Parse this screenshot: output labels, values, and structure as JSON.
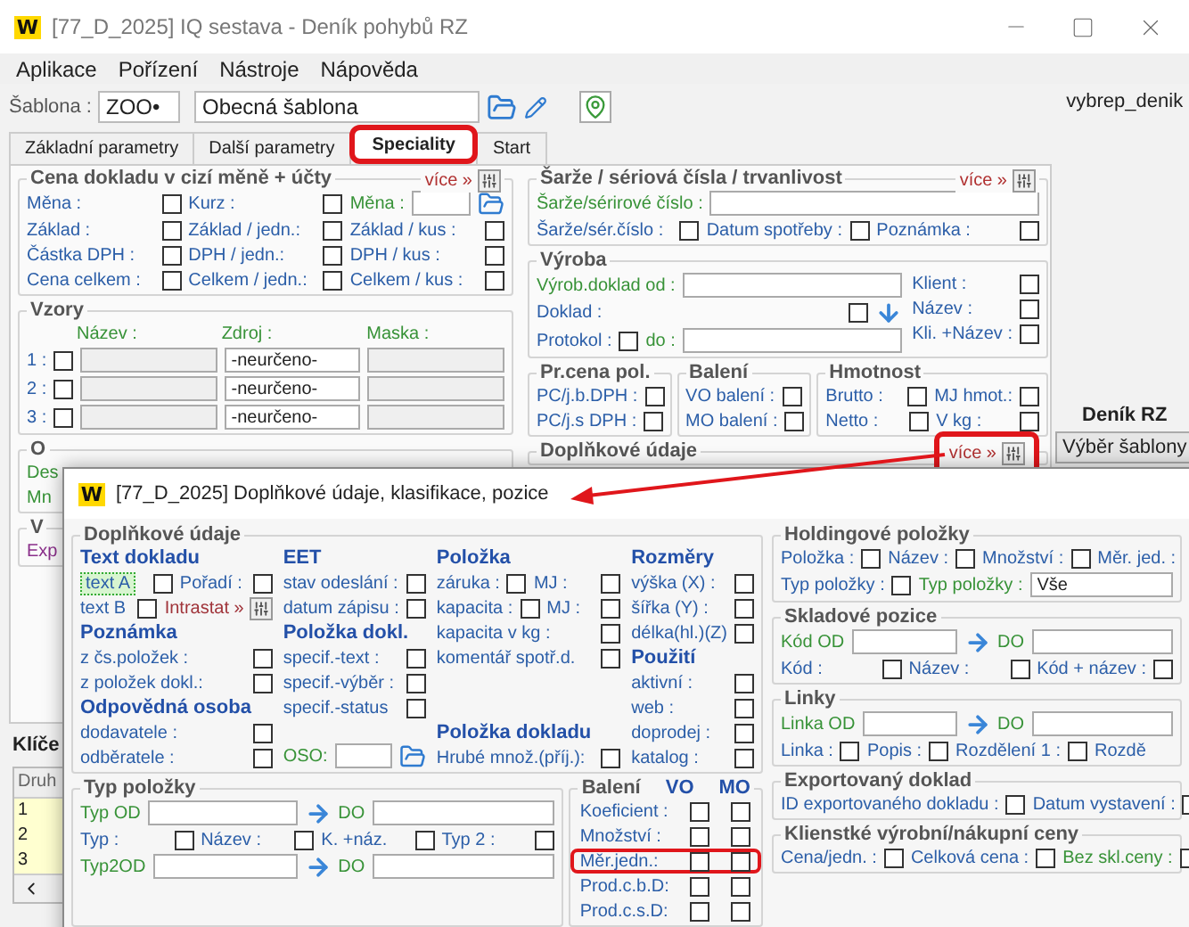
{
  "window": {
    "logo": "W",
    "title": "[77_D_2025] IQ sestava - Deník pohybů RZ"
  },
  "menu": [
    "Aplikace",
    "Pořízení",
    "Nástroje",
    "Nápověda"
  ],
  "template": {
    "label": "Šablona :",
    "code": "ZOO•",
    "name": "Obecná šablona"
  },
  "side": {
    "name": "vybrep_denik",
    "title": "Deník RZ",
    "button": "Výběr šablony"
  },
  "tabs": [
    {
      "label": "Základní parametry",
      "selected": false,
      "highlighted": false
    },
    {
      "label": "Další parametry",
      "selected": false,
      "highlighted": false
    },
    {
      "label": "Speciality",
      "selected": true,
      "highlighted": true
    },
    {
      "label": "Start",
      "selected": false,
      "highlighted": false
    }
  ],
  "panel": {
    "left": [
      {
        "kind": "group",
        "title": "Cena dokladu v cizí měně + účty",
        "more": {
          "label": "více »",
          "highlighted": false
        },
        "rows": [
          [
            {
              "kind": "check",
              "label": "Měna :",
              "checked": false
            },
            {
              "kind": "check",
              "label": "Kurz :",
              "checked": false
            },
            {
              "kind": "input",
              "label": "Měna :",
              "browse": true
            }
          ],
          [
            {
              "kind": "check",
              "label": "Základ :",
              "checked": false
            },
            {
              "kind": "check",
              "label": "Základ / jedn.:",
              "checked": false
            },
            {
              "kind": "check",
              "label": "Základ / kus :",
              "checked": false
            }
          ],
          [
            {
              "kind": "check",
              "label": "Částka DPH :",
              "checked": false
            },
            {
              "kind": "check",
              "label": "DPH / jedn.:",
              "checked": false
            },
            {
              "kind": "check",
              "label": "DPH / kus :",
              "checked": false
            }
          ],
          [
            {
              "kind": "check",
              "label": "Cena celkem :",
              "checked": false
            },
            {
              "kind": "check",
              "label": "Celkem / jedn.:",
              "checked": false
            },
            {
              "kind": "check",
              "label": "Celkem / kus :",
              "checked": false
            }
          ]
        ]
      },
      {
        "kind": "group",
        "title": "Vzory",
        "rows": [
          [
            {
              "kind": "header",
              "label": "Název :"
            },
            {
              "kind": "header",
              "label": "Zdroj :"
            },
            {
              "kind": "header",
              "label": "Maska :"
            }
          ],
          [
            {
              "kind": "check",
              "label": "1 :",
              "checked": false
            },
            {
              "kind": "input",
              "disabled": true
            },
            {
              "kind": "input",
              "value": "-neurčeno-",
              "disabled": false
            },
            {
              "kind": "input",
              "disabled": true
            }
          ],
          [
            {
              "kind": "check",
              "label": "2 :",
              "checked": false
            },
            {
              "kind": "input",
              "disabled": true
            },
            {
              "kind": "input",
              "value": "-neurčeno-",
              "disabled": false
            },
            {
              "kind": "input",
              "disabled": true
            }
          ],
          [
            {
              "kind": "check",
              "label": "3 :",
              "checked": false
            },
            {
              "kind": "input",
              "disabled": true
            },
            {
              "kind": "input",
              "value": "-neurčeno-",
              "disabled": false
            },
            {
              "kind": "input",
              "disabled": true
            }
          ]
        ]
      },
      {
        "kind": "group",
        "title": "O",
        "rows": [
          [
            {
              "kind": "text",
              "label": "Des",
              "color": "#379237"
            }
          ],
          [
            {
              "kind": "text",
              "label": "Mn",
              "color": "#379237"
            }
          ]
        ]
      },
      {
        "kind": "group",
        "title": "V",
        "rows": [
          [
            {
              "kind": "text",
              "label": "Exp",
              "color": "#8a2f8a"
            }
          ]
        ]
      }
    ],
    "right": [
      {
        "kind": "group",
        "title": "Šarže / sériová čísla / trvanlivost",
        "more": {
          "label": "více »",
          "highlighted": false
        },
        "rows": [
          [
            {
              "kind": "input",
              "label": "Šarže/sérirové číslo :"
            }
          ],
          [
            {
              "kind": "check",
              "label": "Šarže/sér.číslo :",
              "checked": false
            },
            {
              "kind": "check",
              "label": "Datum spotřeby :",
              "checked": false
            },
            {
              "kind": "check",
              "label": "Poznámka :",
              "checked": false
            }
          ]
        ]
      },
      {
        "kind": "group",
        "title": "Výroba",
        "columns": [
          {
            "rows": [
              [
                {
                  "kind": "input",
                  "label": "Výrob.doklad od :"
                }
              ],
              [
                {
                  "kind": "check",
                  "label": "Doklad :",
                  "checked": false
                },
                {
                  "kind": "arrow_down"
                }
              ],
              [
                {
                  "kind": "check",
                  "label": "Protokol :",
                  "checked": false
                },
                {
                  "kind": "input",
                  "label": "do :"
                }
              ]
            ]
          },
          {
            "rows": [
              [
                {
                  "kind": "check",
                  "label": "Klient :",
                  "checked": false
                }
              ],
              [
                {
                  "kind": "check",
                  "label": "Název :",
                  "checked": false
                }
              ],
              [
                {
                  "kind": "check",
                  "label": "Kli. +Název :",
                  "checked": false
                }
              ]
            ]
          }
        ]
      },
      {
        "kind": "group_row",
        "groups": [
          {
            "title": "Pr.cena pol.",
            "rows": [
              [
                {
                  "kind": "check",
                  "label": "PC/j.b.DPH :",
                  "checked": false
                }
              ],
              [
                {
                  "kind": "check",
                  "label": "PC/j.s DPH :",
                  "checked": false
                }
              ]
            ]
          },
          {
            "title": "Balení",
            "rows": [
              [
                {
                  "kind": "check",
                  "label": "VO balení :",
                  "checked": false
                }
              ],
              [
                {
                  "kind": "check",
                  "label": "MO balení :",
                  "checked": false
                }
              ]
            ]
          },
          {
            "title": "Hmotnost",
            "rows": [
              [
                {
                  "kind": "check",
                  "label": "Brutto :",
                  "checked": false
                },
                {
                  "kind": "check",
                  "label": "MJ hmot.:",
                  "checked": false
                }
              ],
              [
                {
                  "kind": "check",
                  "label": "Netto :",
                  "checked": false
                },
                {
                  "kind": "check",
                  "label": "V kg :",
                  "checked": false
                }
              ]
            ]
          }
        ]
      },
      {
        "kind": "group",
        "title": "Doplňkové údaje",
        "more": {
          "label": "více »",
          "highlighted": true
        }
      }
    ]
  },
  "keys": {
    "title": "Klíče",
    "column": "Druh",
    "rows": [
      "1",
      "2",
      "3"
    ]
  },
  "callout_arrow": true,
  "dialog": {
    "logo": "W",
    "title": "[77_D_2025] Doplňkové údaje, klasifikace, pozice",
    "left": [
      {
        "kind": "group",
        "title": "Doplňkové údaje",
        "columns": [
          {
            "rows": [
              [
                {
                  "kind": "heading",
                  "label": "Text dokladu"
                }
              ],
              [
                {
                  "kind": "check",
                  "label": "text A",
                  "checked": false,
                  "focused": true
                },
                {
                  "kind": "check",
                  "label": "Pořadí :",
                  "checked": false
                }
              ],
              [
                {
                  "kind": "check",
                  "label": "text B",
                  "checked": false
                },
                {
                  "kind": "more",
                  "label": "Intrastat »",
                  "color": "#a0343a"
                }
              ],
              [
                {
                  "kind": "heading",
                  "label": "Poznámka"
                }
              ],
              [
                {
                  "kind": "check",
                  "label": "z čs.položek :",
                  "checked": false
                }
              ],
              [
                {
                  "kind": "check",
                  "label": "z položek dokl.:",
                  "checked": false
                }
              ],
              [
                {
                  "kind": "heading",
                  "label": "Odpovědná osoba"
                }
              ],
              [
                {
                  "kind": "check",
                  "label": "dodavatele :",
                  "checked": false
                }
              ],
              [
                {
                  "kind": "check",
                  "label": "odběratele :",
                  "checked": false
                }
              ]
            ]
          },
          {
            "rows": [
              [
                {
                  "kind": "heading",
                  "label": "EET"
                }
              ],
              [
                {
                  "kind": "check",
                  "label": "stav odeslání :",
                  "checked": false
                }
              ],
              [
                {
                  "kind": "check",
                  "label": "datum zápisu :",
                  "checked": false
                }
              ],
              [
                {
                  "kind": "heading",
                  "label": "Položka dokl."
                }
              ],
              [
                {
                  "kind": "check",
                  "label": "specif.-text :",
                  "checked": false
                }
              ],
              [
                {
                  "kind": "check",
                  "label": "specif.-výběr :",
                  "checked": false
                }
              ],
              [
                {
                  "kind": "check",
                  "label": "specif.-status",
                  "checked": false
                }
              ]
            ],
            "footer": [
              [
                {
                  "kind": "input",
                  "label": "OSO:",
                  "browse": true
                }
              ]
            ]
          },
          {
            "rows": [
              [
                {
                  "kind": "heading",
                  "label": "Položka"
                }
              ],
              [
                {
                  "kind": "check",
                  "label": "záruka :",
                  "checked": false
                },
                {
                  "kind": "check",
                  "label": "MJ :",
                  "checked": false
                }
              ],
              [
                {
                  "kind": "check",
                  "label": "kapacita :",
                  "checked": false
                },
                {
                  "kind": "check",
                  "label": "MJ :",
                  "checked": false
                }
              ],
              [
                {
                  "kind": "check",
                  "label": "kapacita v kg :",
                  "checked": false
                }
              ],
              [
                {
                  "kind": "check",
                  "label": "komentář spotř.d.",
                  "checked": false
                }
              ]
            ],
            "footer": [
              [
                {
                  "kind": "heading",
                  "label": "Položka dokladu"
                }
              ],
              [
                {
                  "kind": "check",
                  "label": "Hrubé množ.(příj.):",
                  "checked": false
                }
              ]
            ]
          },
          {
            "rows": [
              [
                {
                  "kind": "heading",
                  "label": "Rozměry"
                }
              ],
              [
                {
                  "kind": "check",
                  "label": "výška (X) :",
                  "checked": false
                }
              ],
              [
                {
                  "kind": "check",
                  "label": "šířka (Y) :",
                  "checked": false
                }
              ],
              [
                {
                  "kind": "check",
                  "label": "délka(hl.)(Z)",
                  "checked": false
                }
              ],
              [
                {
                  "kind": "heading",
                  "label": "Použití"
                }
              ],
              [
                {
                  "kind": "check",
                  "label": "aktivní :",
                  "checked": false
                }
              ],
              [
                {
                  "kind": "check",
                  "label": "web :",
                  "checked": false
                }
              ],
              [
                {
                  "kind": "check",
                  "label": "doprodej :",
                  "checked": false
                }
              ],
              [
                {
                  "kind": "check",
                  "label": "katalog :",
                  "checked": false
                }
              ]
            ]
          }
        ]
      },
      {
        "kind": "group_row",
        "groups": [
          {
            "title": "Typ položky",
            "rows": [
              [
                {
                  "kind": "input",
                  "label": "Typ OD"
                },
                {
                  "kind": "arrow_right"
                },
                {
                  "kind": "input",
                  "label": "DO"
                }
              ],
              [
                {
                  "kind": "check",
                  "label": "Typ :",
                  "checked": false
                },
                {
                  "kind": "check",
                  "label": "Název :",
                  "checked": false
                },
                {
                  "kind": "check",
                  "label": "K. +náz.",
                  "checked": false
                },
                {
                  "kind": "check",
                  "label": "Typ 2 :",
                  "checked": false
                }
              ],
              [
                {
                  "kind": "input",
                  "label": "Typ2OD"
                },
                {
                  "kind": "arrow_right"
                },
                {
                  "kind": "input",
                  "label": "DO"
                }
              ]
            ]
          },
          {
            "title": "Balení",
            "headers": [
              "VO",
              "MO"
            ],
            "rows": [
              [
                {
                  "kind": "pair",
                  "label": "Koeficient :",
                  "checks": [
                    false,
                    false
                  ],
                  "highlighted": false
                }
              ],
              [
                {
                  "kind": "pair",
                  "label": "Množství :",
                  "checks": [
                    false,
                    false
                  ],
                  "highlighted": false
                }
              ],
              [
                {
                  "kind": "pair",
                  "label": "Měr.jedn.:",
                  "checks": [
                    false,
                    false
                  ],
                  "highlighted": true
                }
              ],
              [
                {
                  "kind": "pair",
                  "label": "Prod.c.b.D:",
                  "checks": [
                    false,
                    false
                  ],
                  "highlighted": false
                }
              ],
              [
                {
                  "kind": "pair",
                  "label": "Prod.c.s.D:",
                  "checks": [
                    false,
                    false
                  ],
                  "highlighted": false
                }
              ]
            ]
          }
        ]
      }
    ],
    "right": [
      {
        "kind": "group",
        "title": "Holdingové položky",
        "rows": [
          [
            {
              "kind": "check",
              "label": "Položka :",
              "checked": false
            },
            {
              "kind": "check",
              "label": "Název :",
              "checked": false
            },
            {
              "kind": "check",
              "label": "Množství :",
              "checked": false
            },
            {
              "kind": "text",
              "label": "Měr. jed. :"
            }
          ],
          [
            {
              "kind": "check",
              "label": "Typ položky :",
              "checked": false
            },
            {
              "kind": "input",
              "label": "Typ položky :",
              "value": "Vše"
            }
          ]
        ]
      },
      {
        "kind": "group",
        "title": "Skladové pozice",
        "rows": [
          [
            {
              "kind": "input",
              "label": "Kód OD"
            },
            {
              "kind": "arrow_right"
            },
            {
              "kind": "input",
              "label": "DO"
            }
          ],
          [
            {
              "kind": "check",
              "label": "Kód :",
              "checked": false
            },
            {
              "kind": "check",
              "label": "Název :",
              "checked": false
            },
            {
              "kind": "check",
              "label": "Kód + název :",
              "checked": false
            }
          ]
        ]
      },
      {
        "kind": "group",
        "title": "Linky",
        "rows": [
          [
            {
              "kind": "input",
              "label": "Linka OD"
            },
            {
              "kind": "arrow_right"
            },
            {
              "kind": "input",
              "label": "DO"
            }
          ],
          [
            {
              "kind": "check",
              "label": "Linka :",
              "checked": false
            },
            {
              "kind": "check",
              "label": "Popis :",
              "checked": false
            },
            {
              "kind": "check",
              "label": "Rozdělení 1 :",
              "checked": false
            },
            {
              "kind": "text",
              "label": "Rozdě"
            }
          ]
        ]
      },
      {
        "kind": "group",
        "title": "Exportovaný doklad",
        "rows": [
          [
            {
              "kind": "check",
              "label": "ID exportovaného dokladu :",
              "checked": false
            },
            {
              "kind": "check",
              "label": "Datum vystavení :",
              "checked": false
            }
          ]
        ]
      },
      {
        "kind": "group",
        "title": "Klienstké výrobní/nákupní ceny",
        "rows": [
          [
            {
              "kind": "check",
              "label": "Cena/jedn. :",
              "checked": false
            },
            {
              "kind": "check",
              "label": "Celková cena :",
              "checked": false
            },
            {
              "kind": "check",
              "label": "Bez skl.ceny :",
              "checked": false,
              "color": "#379237"
            }
          ]
        ]
      }
    ]
  }
}
